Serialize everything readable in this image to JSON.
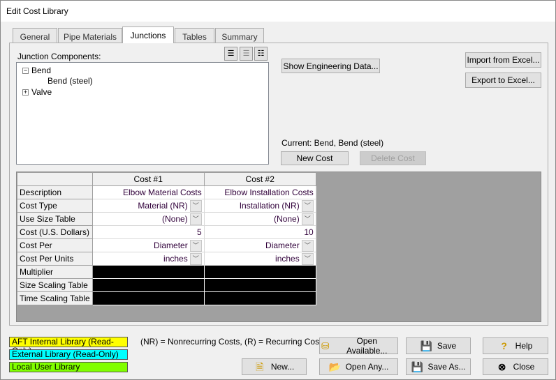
{
  "window": {
    "title": "Edit Cost Library"
  },
  "tabs": [
    {
      "label": "General"
    },
    {
      "label": "Pipe Materials"
    },
    {
      "label": "Junctions"
    },
    {
      "label": "Tables"
    },
    {
      "label": "Summary"
    }
  ],
  "active_tab": "Junctions",
  "junctions": {
    "components_label": "Junction Components:",
    "tree": [
      {
        "label": "Bend",
        "expander": "−",
        "children": [
          {
            "label": "Bend (steel)"
          }
        ]
      },
      {
        "label": "Valve",
        "expander": "+"
      }
    ],
    "show_engineering_label": "Show Engineering Data...",
    "import_label": "Import from Excel...",
    "export_label": "Export to Excel...",
    "current_label": "Current: Bend, Bend (steel)",
    "new_cost_label": "New Cost",
    "delete_cost_label": "Delete Cost"
  },
  "table": {
    "columns": [
      "Cost #1",
      "Cost #2"
    ],
    "rows": [
      {
        "label": "Description",
        "values": [
          "Elbow Material Costs",
          "Elbow Installation Costs"
        ]
      },
      {
        "label": "Cost Type",
        "values": [
          "Material (NR)",
          "Installation (NR)"
        ]
      },
      {
        "label": "Use Size Table",
        "values": [
          "(None)",
          "(None)"
        ]
      },
      {
        "label": "Cost (U.S. Dollars)",
        "values": [
          "5",
          "10"
        ]
      },
      {
        "label": "Cost Per",
        "values": [
          "Diameter",
          "Diameter"
        ]
      },
      {
        "label": "Cost Per Units",
        "values": [
          "inches",
          "inches"
        ]
      },
      {
        "label": "Multiplier"
      },
      {
        "label": "Size Scaling Table"
      },
      {
        "label": "Time Scaling Table"
      }
    ]
  },
  "legend": [
    {
      "label": "AFT Internal Library (Read-Only)",
      "color": "#ffff00"
    },
    {
      "label": "External Library (Read-Only)",
      "color": "#00ffff"
    },
    {
      "label": "Local User Library",
      "color": "#80ff00"
    }
  ],
  "note": "(NR) = Nonrecurring Costs, (R) = Recurring Costs",
  "buttons": {
    "open_available": "Open Available...",
    "new": "New...",
    "open_any": "Open Any...",
    "save": "Save",
    "save_as": "Save As...",
    "help": "Help",
    "close": "Close"
  }
}
